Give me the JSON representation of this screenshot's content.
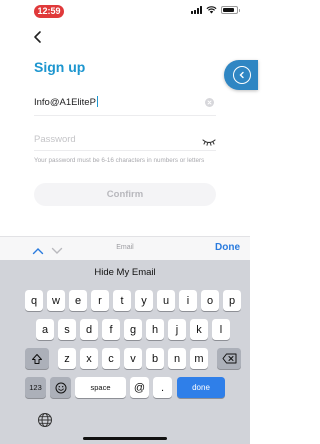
{
  "status_bar": {
    "time": "12:59"
  },
  "page": {
    "title": "Sign up"
  },
  "form": {
    "email_value": "Info@A1EliteP",
    "password_placeholder": "Password",
    "hint": "Your password must be 6-16 characters in numbers or letters",
    "confirm_label": "Confirm"
  },
  "keyboard": {
    "accessory_field_label": "Email",
    "done_label": "Done",
    "suggestion": "Hide My Email",
    "rows": [
      [
        "q",
        "w",
        "e",
        "r",
        "t",
        "y",
        "u",
        "i",
        "o",
        "p"
      ],
      [
        "a",
        "s",
        "d",
        "f",
        "g",
        "h",
        "j",
        "k",
        "l"
      ],
      [
        "z",
        "x",
        "c",
        "v",
        "b",
        "n",
        "m"
      ]
    ],
    "numbers_key": "123",
    "space_label": "space",
    "at_key": "@",
    "dot_key": ".",
    "return_label": "done"
  },
  "colors": {
    "accent": "#1d96cf",
    "side_tab": "#2f86c3",
    "status_time_bg": "#e0393a",
    "keyboard_done": "#2f7fe9"
  }
}
